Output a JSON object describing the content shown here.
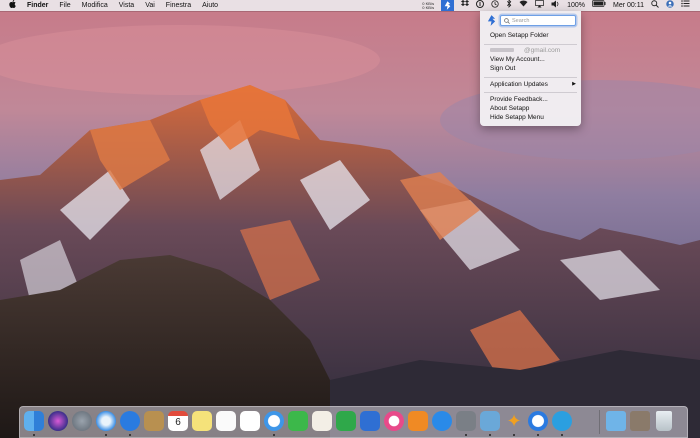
{
  "menubar": {
    "apple_icon": "apple-logo-icon",
    "app_name": "Finder",
    "menus": [
      "File",
      "Modifica",
      "Vista",
      "Vai",
      "Finestra",
      "Aiuto"
    ],
    "network": {
      "up": "0 KB/s",
      "down": "0 KB/s"
    },
    "battery": "100%",
    "clock": "Mer 00:11",
    "status_icons": [
      "setapp-icon",
      "dropbox-icon",
      "1password-icon",
      "time-machine-icon",
      "bluetooth-icon",
      "wifi-icon",
      "airplay-icon",
      "volume-icon",
      "battery-icon",
      "spotlight-icon",
      "user-icon",
      "notification-center-icon"
    ]
  },
  "setapp_menu": {
    "search_placeholder": "Search",
    "open_folder": "Open Setapp Folder",
    "email_domain": "@gmail.com",
    "view_account": "View My Account...",
    "sign_out": "Sign Out",
    "app_updates": "Application Updates",
    "provide_feedback": "Provide Feedback...",
    "about": "About Setapp",
    "hide": "Hide Setapp Menu"
  },
  "dock": {
    "calendar_day": "6",
    "apps": [
      "finder",
      "siri",
      "launchpad",
      "safari",
      "testflight",
      "notes-book",
      "calendar",
      "stickies",
      "reminders",
      "photos",
      "messages",
      "facetime",
      "textedit",
      "numbers",
      "keynote",
      "itunes",
      "ibooks",
      "app-store",
      "system-preferences",
      "preview",
      "tes",
      "1password",
      "telegram",
      "downloads-folder",
      "photo-stack",
      "trash"
    ]
  },
  "colors": {
    "menubar_bg": "#ece8ec",
    "setapp_blue": "#2f6fd3",
    "highlight": "#6fa0e6"
  }
}
